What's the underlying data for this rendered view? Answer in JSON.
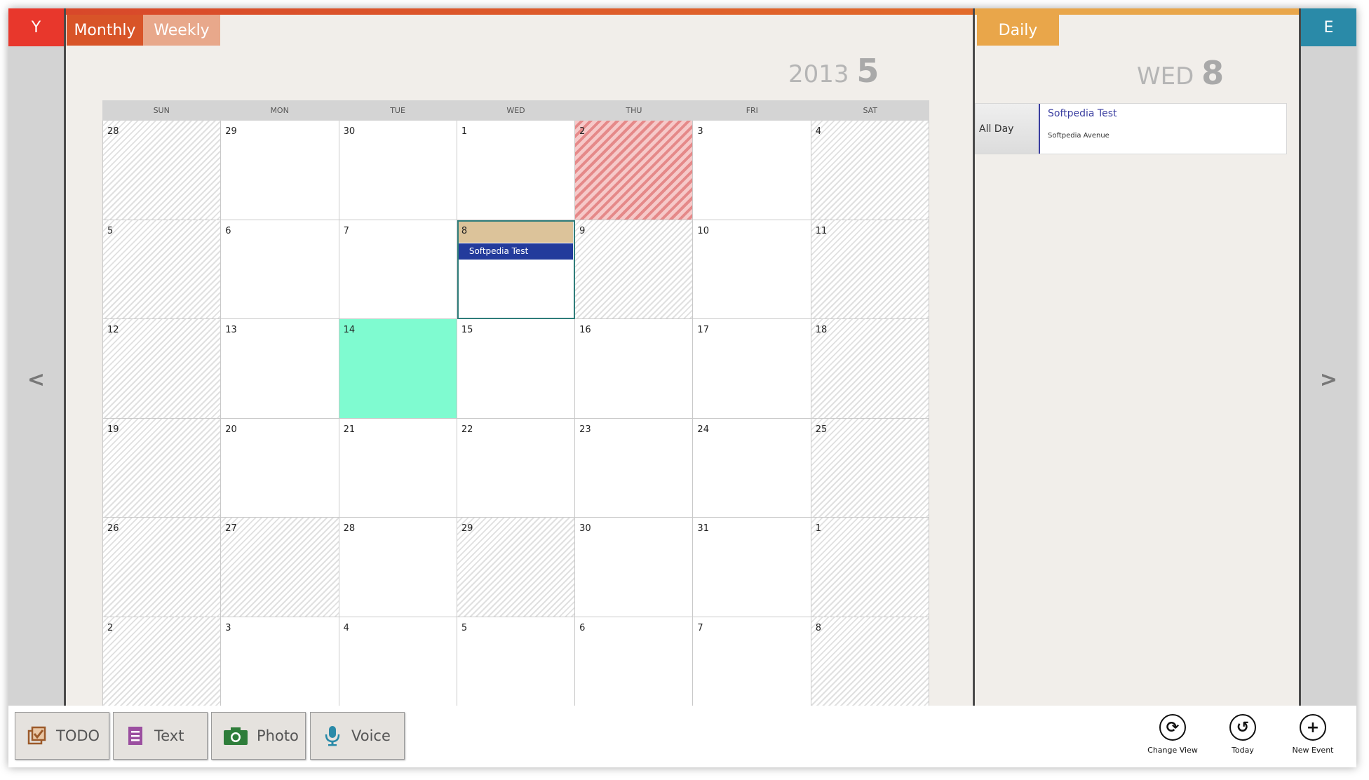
{
  "app": {
    "left_tab": "Y",
    "right_tab": "E",
    "prev_arrow": "<",
    "next_arrow": ">"
  },
  "tabs": {
    "monthly": "Monthly",
    "weekly": "Weekly",
    "daily": "Daily"
  },
  "colors": {
    "monthly_accent": "#d85428",
    "weekly_accent": "#e8a88b",
    "daily_accent": "#e9a64a",
    "event_blue": "#233b9c",
    "today_mint": "#7ffbd0",
    "selected_tan": "#dcc39a"
  },
  "month": {
    "year": "2013",
    "month": "5",
    "days_of_week": [
      "SUN",
      "MON",
      "TUE",
      "WED",
      "THU",
      "FRI",
      "SAT"
    ],
    "weeks": [
      [
        "28",
        "29",
        "30",
        "1",
        "2",
        "3",
        "4"
      ],
      [
        "5",
        "6",
        "7",
        "8",
        "9",
        "10",
        "11"
      ],
      [
        "12",
        "13",
        "14",
        "15",
        "16",
        "17",
        "18"
      ],
      [
        "19",
        "20",
        "21",
        "22",
        "23",
        "24",
        "25"
      ],
      [
        "26",
        "27",
        "28",
        "29",
        "30",
        "31",
        "1"
      ],
      [
        "2",
        "3",
        "4",
        "5",
        "6",
        "7",
        "8"
      ]
    ],
    "event_label": "Softpedia Test"
  },
  "daily": {
    "weekday": "WED",
    "day": "8",
    "all_day_label": "All Day",
    "event_title": "Softpedia Test",
    "event_location": "Softpedia Avenue"
  },
  "toolbar": {
    "todo": "TODO",
    "text": "Text",
    "photo": "Photo",
    "voice": "Voice",
    "change_view": "Change View",
    "today": "Today",
    "new_event": "New Event"
  },
  "icons": {
    "todo": "checkbox-icon",
    "text": "document-icon",
    "photo": "camera-icon",
    "voice": "microphone-icon",
    "change_view": "refresh-icon",
    "today": "undo-icon",
    "new_event": "plus-icon"
  }
}
